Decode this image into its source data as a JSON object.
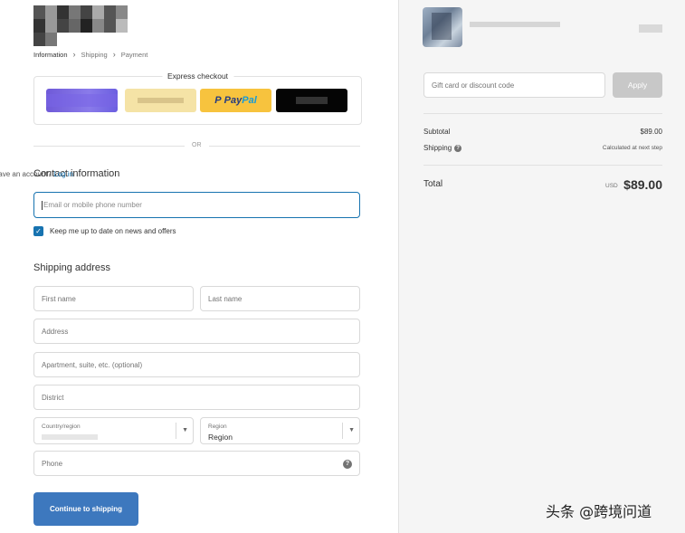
{
  "breadcrumb": {
    "items": [
      "Information",
      "Shipping",
      "Payment"
    ],
    "separator": "›"
  },
  "express_checkout": {
    "title": "Express checkout",
    "paypal_label": [
      "P",
      "Pay",
      "Pal"
    ]
  },
  "divider_text": "OR",
  "contact": {
    "title": "Contact information",
    "login_prompt": "Already have an account?",
    "login_link": "Log in",
    "email_placeholder": "Email or mobile phone number",
    "newsletter_label": "Keep me up to date on news and offers",
    "newsletter_checked": true
  },
  "shipping": {
    "title": "Shipping address",
    "first_name_placeholder": "First name",
    "last_name_placeholder": "Last name",
    "address_placeholder": "Address",
    "apartment_placeholder": "Apartment, suite, etc. (optional)",
    "district_placeholder": "District",
    "country_label": "Country/region",
    "region_label": "Region",
    "region_value": "Region",
    "phone_placeholder": "Phone",
    "continue_label": "Continue to shipping"
  },
  "summary": {
    "discount_placeholder": "Gift card or discount code",
    "apply_label": "Apply",
    "subtotal_label": "Subtotal",
    "subtotal_value": "$89.00",
    "shipping_label": "Shipping",
    "shipping_value": "Calculated at next step",
    "total_label": "Total",
    "total_currency": "USD",
    "total_value": "$89.00"
  },
  "watermark": "头条 @跨境问道",
  "colors": {
    "accent": "#1773b0",
    "button": "#3d78be",
    "paypal_yellow": "#f7c33e",
    "summary_bg": "#f5f5f5"
  }
}
